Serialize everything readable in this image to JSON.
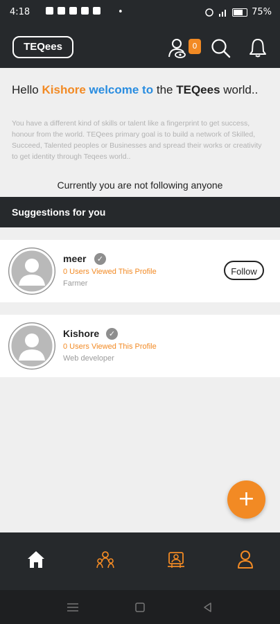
{
  "status_bar": {
    "time": "4:18",
    "dot": "•",
    "battery": "75%"
  },
  "app_bar": {
    "logo": "TEQees",
    "viewer_count": "0"
  },
  "welcome": {
    "hello": "Hello",
    "user_name": "Kishore",
    "welcome_to": "welcome to",
    "the": "the",
    "brand": "TEQees",
    "world": "world..",
    "description": "You have a different kind of skills or talent like a fingerprint to get success, honour from the world. TEQees primary goal is to build a network of Skilled, Succeed, Talented peoples or Businesses  and spread  their works or creativity to get identity through Teqees world..",
    "not_following": "Currently you are not following anyone"
  },
  "suggestions": {
    "title": "Suggestions for you",
    "users": [
      {
        "name": "meer",
        "views": "0 Users Viewed This Profile",
        "role": "Farmer",
        "follow_label": "Follow"
      },
      {
        "name": "Kishore",
        "views": "0 Users Viewed This Profile",
        "role": "Web developer"
      }
    ]
  },
  "fab": {
    "icon": "plus-icon",
    "label": "+"
  },
  "bottom_nav": {
    "items": [
      "home-icon",
      "group-icon",
      "post-board-icon",
      "profile-icon"
    ]
  },
  "colors": {
    "accent": "#f28a24",
    "blue": "#2a8de0",
    "dark": "#26292c"
  }
}
